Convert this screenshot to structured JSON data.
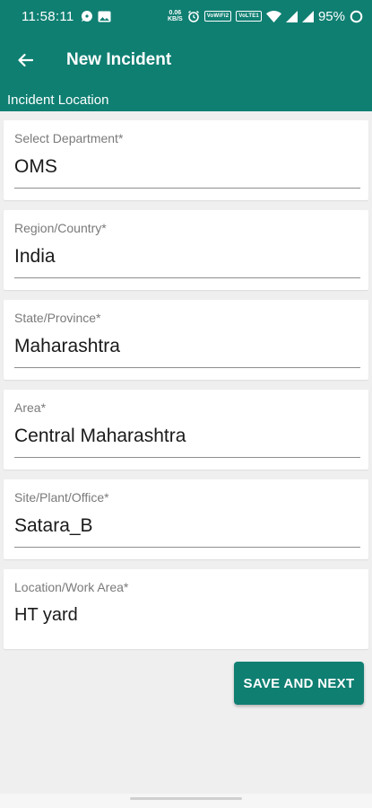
{
  "status_bar": {
    "time": "11:58:11",
    "speed_top": "0.06",
    "speed_bottom": "KB/S",
    "vowifi1": "VoWiFi2",
    "vowifi2": "VoLTE1",
    "battery": "95%",
    "icons": [
      "chat-icon",
      "gallery-icon",
      "alarm-icon",
      "wifi-icon",
      "signal-icon",
      "signal-icon",
      "battery-icon"
    ]
  },
  "app_bar": {
    "title": "New Incident",
    "back_icon": "arrow-left-icon"
  },
  "section": {
    "title": "Incident Location"
  },
  "fields": [
    {
      "label": "Select Department*",
      "value": "OMS"
    },
    {
      "label": "Region/Country*",
      "value": "India"
    },
    {
      "label": "State/Province*",
      "value": "Maharashtra"
    },
    {
      "label": "Area*",
      "value": "Central Maharashtra"
    },
    {
      "label": "Site/Plant/Office*",
      "value": "Satara_B"
    },
    {
      "label": "Location/Work Area*",
      "value": "HT yard"
    }
  ],
  "actions": {
    "save_next_label": "SAVE AND NEXT"
  },
  "colors": {
    "primary": "#0f7f72",
    "background": "#efefef"
  }
}
